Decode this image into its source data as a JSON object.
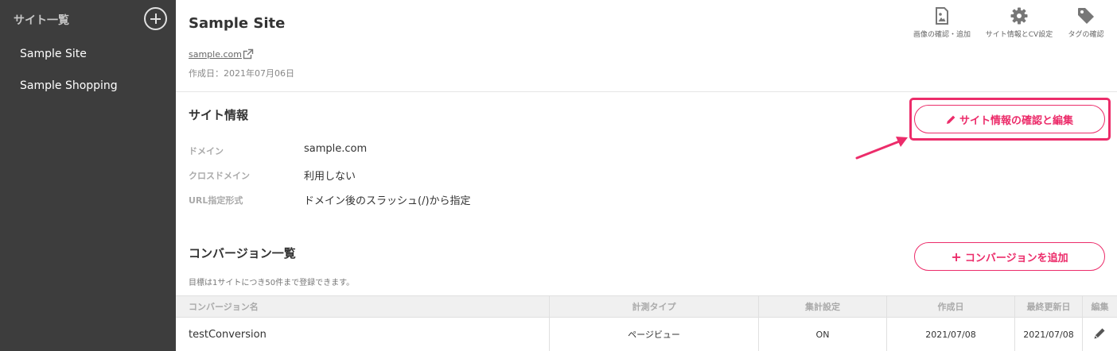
{
  "sidebar": {
    "title": "サイト一覧",
    "add_icon": "plus-circle-icon",
    "items": [
      {
        "label": "Sample Site"
      },
      {
        "label": "Sample Shopping"
      }
    ]
  },
  "site": {
    "title": "Sample Site",
    "url": "sample.com",
    "created": "作成日：2021年07月06日"
  },
  "toolbar": {
    "images_label": "画像の確認・追加",
    "settings_label": "サイト情報とCV設定",
    "tags_label": "タグの確認"
  },
  "site_info": {
    "title": "サイト情報",
    "edit_button": "サイト情報の確認と編集",
    "rows": [
      {
        "label": "ドメイン",
        "value": "sample.com"
      },
      {
        "label": "クロスドメイン",
        "value": "利用しない"
      },
      {
        "label": "URL指定形式",
        "value": "ドメイン後のスラッシュ(/)から指定"
      }
    ]
  },
  "conversions": {
    "title": "コンバージョン一覧",
    "add_button": "コンバージョンを追加",
    "note": "目標は1サイトにつき50件まで登録できます。",
    "columns": [
      "コンバージョン名",
      "計測タイプ",
      "集計設定",
      "作成日",
      "最終更新日",
      "編集"
    ],
    "rows": [
      {
        "name": "testConversion",
        "type": "ページビュー",
        "aggregate": "ON",
        "created": "2021/07/08",
        "updated": "2021/07/08"
      }
    ]
  },
  "colors": {
    "accent": "#ec2c6a",
    "sidebar_bg": "#3d3d3d"
  }
}
